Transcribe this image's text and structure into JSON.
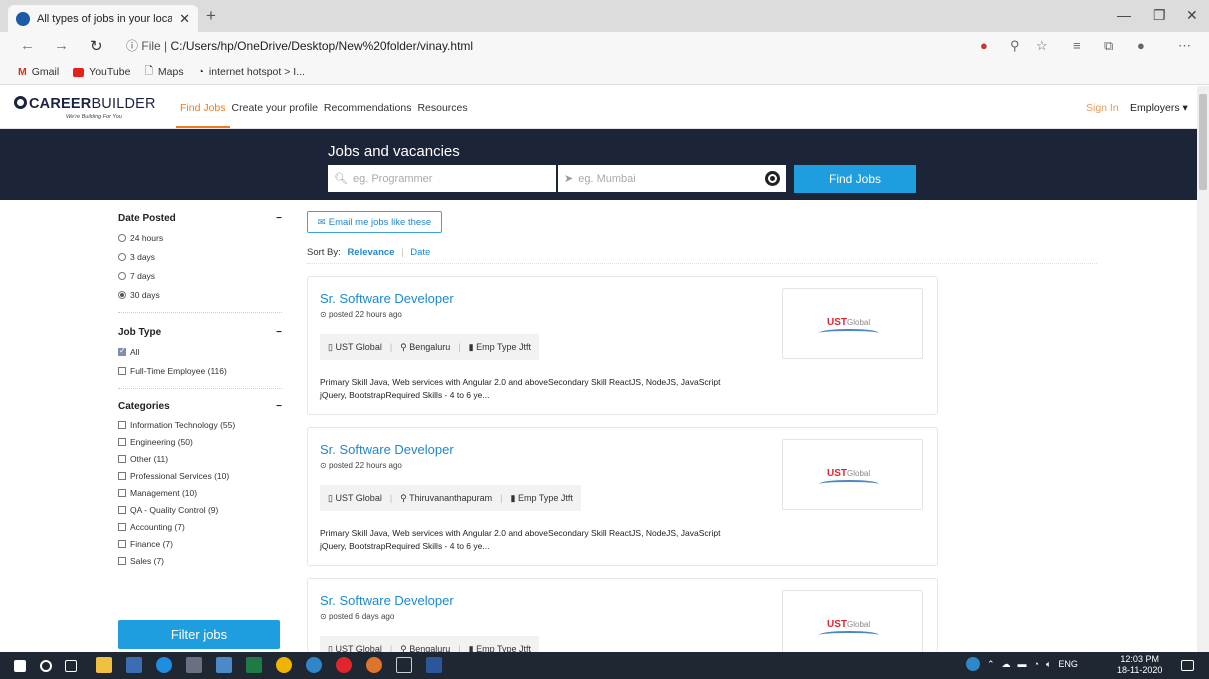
{
  "browser": {
    "tab_title": "All types of jobs in your local are",
    "address_label": "File",
    "address": "C:/Users/hp/OneDrive/Desktop/New%20folder/vinay.html",
    "bookmarks": [
      "Gmail",
      "YouTube",
      "Maps",
      "internet hotspot > I..."
    ]
  },
  "site": {
    "logo_bold": "CAREER",
    "logo_thin": "BUILDER",
    "tagline": "We're Building For You",
    "nav": [
      "Find Jobs",
      "Create your profile",
      "Recommendations",
      "Resources"
    ],
    "sign_in": "Sign In",
    "employers": "Employers ▾"
  },
  "hero": {
    "title": "Jobs and vacancies",
    "keyword_placeholder": "eg. Programmer",
    "location_placeholder": "eg. Mumbai",
    "find_button": "Find Jobs"
  },
  "filters": {
    "date_posted": {
      "title": "Date Posted",
      "options": [
        "24 hours",
        "3 days",
        "7 days",
        "30 days"
      ],
      "selected": "30 days"
    },
    "job_type": {
      "title": "Job Type",
      "options": [
        "All",
        "Full-Time Employee (116)"
      ]
    },
    "categories": {
      "title": "Categories",
      "options": [
        "Information Technology (55)",
        "Engineering (50)",
        "Other (11)",
        "Professional Services (10)",
        "Management (10)",
        "QA - Quality Control (9)",
        "Accounting (7)",
        "Finance (7)",
        "Sales (7)"
      ]
    },
    "filter_button": "Filter jobs"
  },
  "results": {
    "email_button": "Email me jobs like these",
    "sort_label": "Sort By:",
    "sort_relevance": "Relevance",
    "sort_date": "Date",
    "jobs": [
      {
        "title": "Sr. Software Developer",
        "posted": "posted 22 hours ago",
        "company": "UST Global",
        "location": "Bengaluru",
        "emp_type": "Emp Type Jtft",
        "description": "Primary Skill Java, Web services with Angular 2.0 and aboveSecondary Skill ReactJS, NodeJS, JavaScript jQuery, BootstrapRequired Skills - 4 to 6 ye..."
      },
      {
        "title": "Sr. Software Developer",
        "posted": "posted 22 hours ago",
        "company": "UST Global",
        "location": "Thiruvananthapuram",
        "emp_type": "Emp Type Jtft",
        "description": "Primary Skill Java, Web services with Angular 2.0 and aboveSecondary Skill ReactJS, NodeJS, JavaScript jQuery, BootstrapRequired Skills - 4 to 6 ye..."
      },
      {
        "title": "Sr. Software Developer",
        "posted": "posted 6 days ago",
        "company": "UST Global",
        "location": "Bengaluru",
        "emp_type": "Emp Type Jtft",
        "description": ""
      }
    ],
    "logo_text": "UST",
    "logo_text_sub": "Global"
  },
  "taskbar": {
    "language": "ENG",
    "time": "12:03 PM",
    "date": "18-11-2020"
  }
}
